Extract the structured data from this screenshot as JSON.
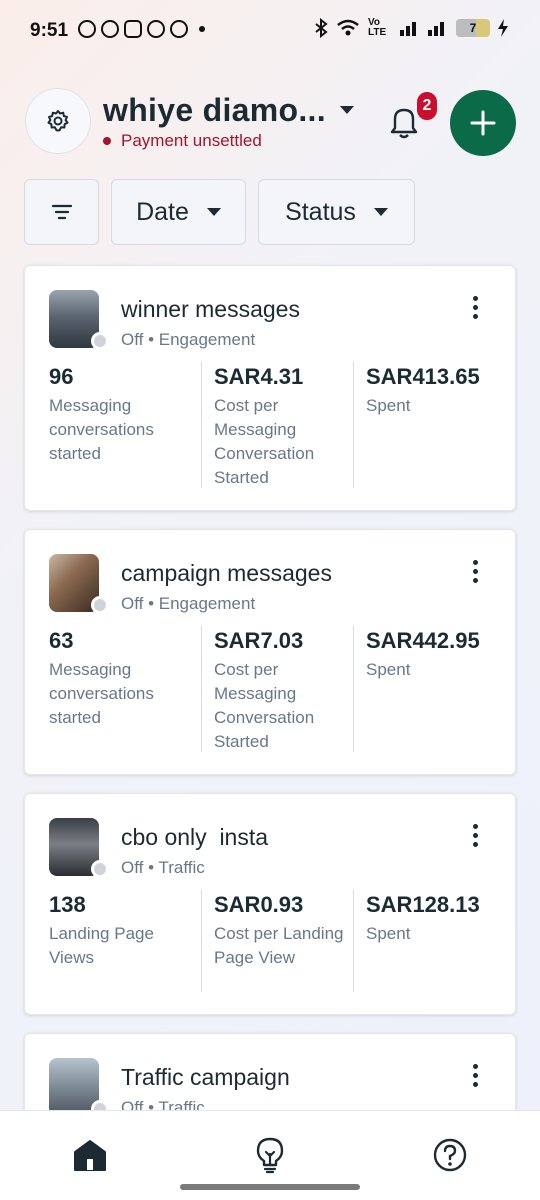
{
  "status_bar": {
    "time": "9:51",
    "network_label": "Vo LTE",
    "battery_level": "7"
  },
  "header": {
    "account_name": "whiye diamo...",
    "account_status": "Payment unsettled",
    "notification_count": "2"
  },
  "filters": {
    "date_label": "Date",
    "status_label": "Status"
  },
  "campaigns": [
    {
      "name": "winner messages",
      "meta": "Off • Engagement",
      "metrics": [
        {
          "value": "96",
          "label": "Messaging conversations started"
        },
        {
          "value": "SAR4.31",
          "label": "Cost per Messaging Conversation Started"
        },
        {
          "value": "SAR413.65",
          "label": "Spent"
        }
      ]
    },
    {
      "name": "campaign messages",
      "meta": "Off • Engagement",
      "metrics": [
        {
          "value": "63",
          "label": "Messaging conversations started"
        },
        {
          "value": "SAR7.03",
          "label": "Cost per Messaging Conversation Started"
        },
        {
          "value": "SAR442.95",
          "label": "Spent"
        }
      ]
    },
    {
      "name": "cbo only  insta",
      "meta": "Off • Traffic",
      "metrics": [
        {
          "value": "138",
          "label": "Landing Page Views"
        },
        {
          "value": "SAR0.93",
          "label": "Cost per Landing Page View"
        },
        {
          "value": "SAR128.13",
          "label": "Spent"
        }
      ]
    },
    {
      "name": "Traffic campaign",
      "meta": "Off • Traffic"
    }
  ],
  "colors": {
    "brand_green": "#0b6b49",
    "alert_red": "#a3152d",
    "badge_red": "#c8102e"
  },
  "icons": {
    "settings": "gear-icon",
    "notifications": "bell-icon",
    "create": "plus-icon",
    "filter": "filter-icon",
    "more": "more-vert-icon",
    "nav_home": "home-icon",
    "nav_insights": "lightbulb-icon",
    "nav_help": "help-icon"
  }
}
